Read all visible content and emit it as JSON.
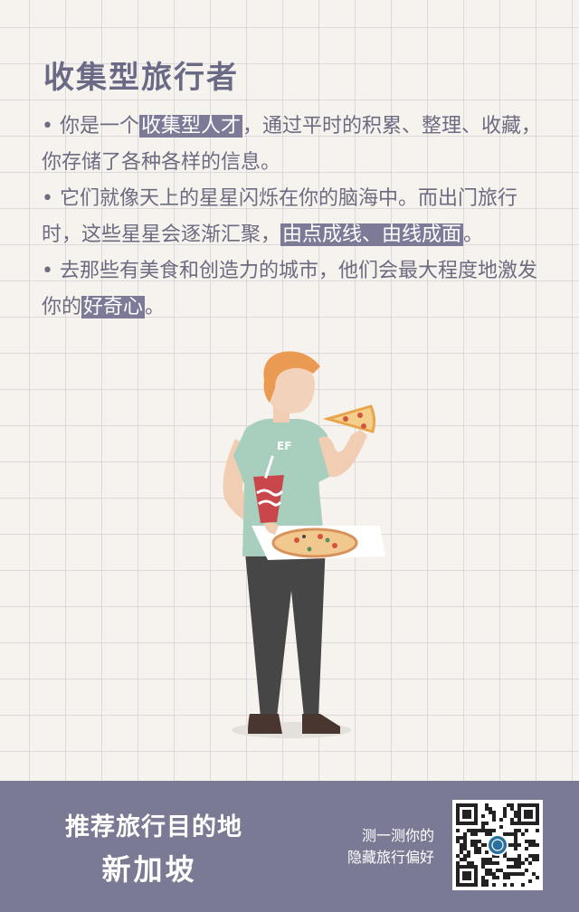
{
  "title": "收集型旅行者",
  "paragraphs": {
    "p1": {
      "bullet": "•",
      "a": "你是一个",
      "hl": "收集型人才",
      "b": "，通过平时的积累、整理、收藏，你存储了各种各样的信息。"
    },
    "p2": {
      "bullet": "•",
      "a": "它们就像天上的星星闪烁在你的脑海中。而出门旅行时，这些星星会逐渐汇聚，",
      "hl": "由点成线、由线成面",
      "b": "。"
    },
    "p3": {
      "bullet": "•",
      "a": "去那些有美食和创造力的城市，他们会最大程度地激发你的",
      "hl": "好奇心",
      "b": "。"
    }
  },
  "illustration": {
    "shirt_text": "EF"
  },
  "footer": {
    "recommend_label": "推荐旅行目的地",
    "city": "新加坡",
    "cta_line1": "测一测你的",
    "cta_line2": "隐藏旅行偏好"
  },
  "colors": {
    "accent": "#7b7a95",
    "text": "#6c6b80",
    "background": "#f6f2ee",
    "highlight": "#7c7a96"
  }
}
